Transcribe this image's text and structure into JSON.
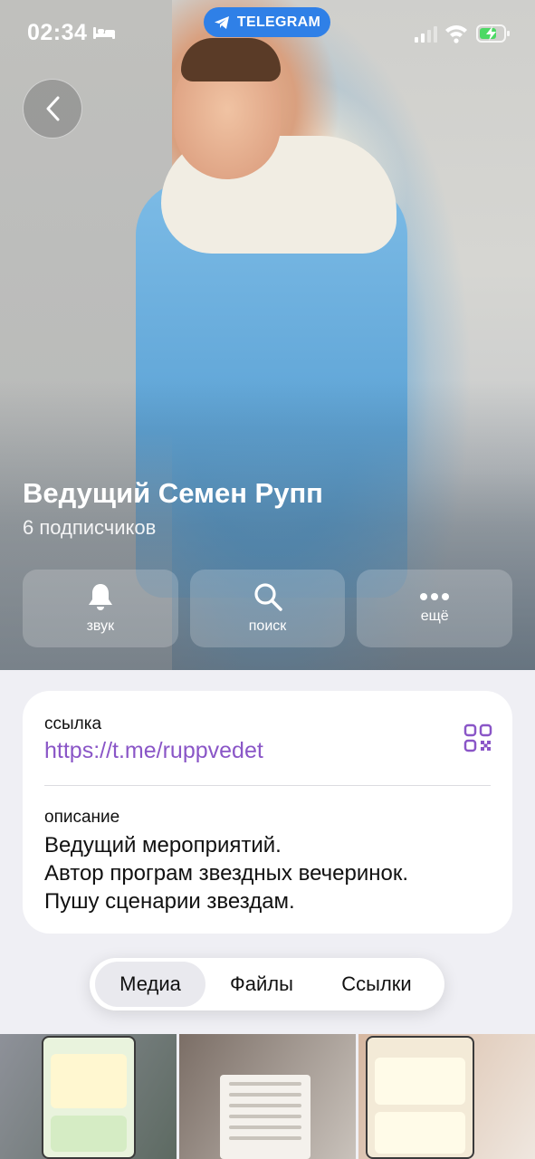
{
  "status": {
    "time": "02:34",
    "source_app": "TELEGRAM"
  },
  "channel": {
    "name": "Ведущий Семен Рупп",
    "subscribers": "6 подписчиков"
  },
  "actions": [
    {
      "icon": "bell-icon",
      "label": "звук"
    },
    {
      "icon": "search-icon",
      "label": "поиск"
    },
    {
      "icon": "more-icon",
      "label": "ещё"
    }
  ],
  "info": {
    "link_label": "ссылка",
    "link_value": "https://t.me/ruppvedet",
    "description_label": "описание",
    "description_lines": [
      "Ведущий мероприятий.",
      "Автор програм звездных вечеринок.",
      "Пушу сценарии звездам."
    ]
  },
  "tabs": {
    "items": [
      "Медиа",
      "Файлы",
      "Ссылки"
    ],
    "selected": "Медиа"
  },
  "colors": {
    "accent_link": "#8a56c7",
    "telegram_pill": "#2f80e7",
    "background": "#efeff4"
  }
}
